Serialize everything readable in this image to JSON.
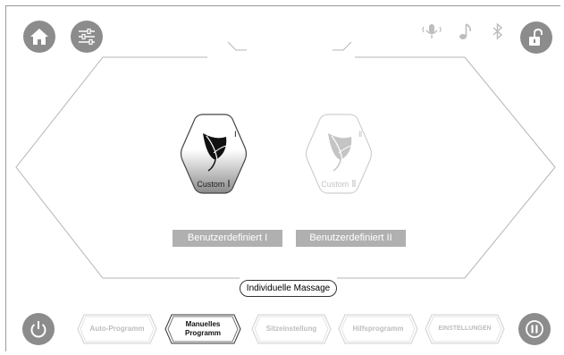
{
  "colors": {
    "button_gray": "#8c8c8c",
    "light_gray": "#bdbdbd",
    "label_gray": "#b0b0b0",
    "active_text": "#111111"
  },
  "header": {
    "left_buttons": [
      {
        "icon": "home-icon"
      },
      {
        "icon": "sliders-icon"
      }
    ],
    "status_icons": [
      "microphone-icon",
      "music-note-icon",
      "bluetooth-icon"
    ],
    "right_button": {
      "icon": "unlock-icon"
    }
  },
  "custom": {
    "items": [
      {
        "label": "Custom",
        "numeral": "Ⅰ",
        "badge": "Ⅰ",
        "button": "Benutzerdefiniert I",
        "selected": true
      },
      {
        "label": "Custom",
        "numeral": "Ⅱ",
        "badge": "Ⅱ",
        "button": "Benutzerdefiniert II",
        "selected": false
      }
    ]
  },
  "mode_title": "Individuelle Massage",
  "footer": {
    "power_icon": "power-icon",
    "pause_icon": "pause-icon",
    "tabs": [
      {
        "label": "Auto-Programm",
        "active": false
      },
      {
        "label": "Manuelles Programm",
        "active": true
      },
      {
        "label": "Sitzeinstellung",
        "active": false
      },
      {
        "label": "Hilfsprogramm",
        "active": false
      },
      {
        "label": "EINSTELLUNGEN",
        "active": false
      }
    ]
  }
}
